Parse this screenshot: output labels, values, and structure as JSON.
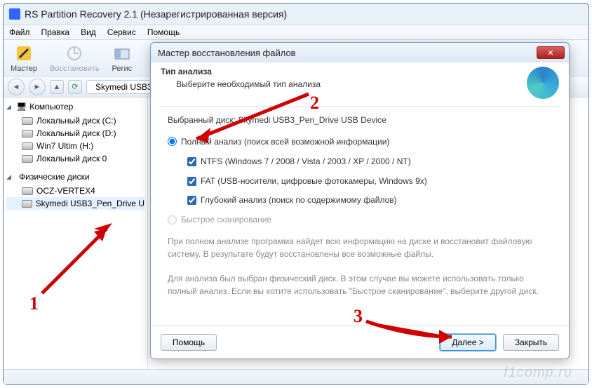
{
  "window": {
    "title": "RS Partition Recovery 2.1 (Незарегистрированная версия)"
  },
  "menu": {
    "file": "Файл",
    "edit": "Правка",
    "view": "Вид",
    "service": "Сервис",
    "help": "Помощь"
  },
  "toolbar": {
    "wizard": "Мастер",
    "recover": "Восстановить",
    "regions": "Регис"
  },
  "breadcrumb": {
    "drive": "Skymedi USB3"
  },
  "tree": {
    "computer": "Компьютер",
    "localC": "Локальный диск (C:)",
    "localD": "Локальный диск (D:)",
    "win7": "Win7 Ultim (H:)",
    "local0": "Локальный диск 0",
    "physical": "Физические диски",
    "ocz": "OCZ-VERTEX4",
    "skymedi": "Skymedi USB3_Pen_Drive U"
  },
  "wizard": {
    "title": "Мастер восстановления файлов",
    "heading": "Тип анализа",
    "subheading": "Выберите необходимый тип анализа",
    "picked_prefix": "Выбранный диск: ",
    "picked_disk": "Skymedi USB3_Pen_Drive USB Device",
    "full_scan": "Полный анализ (поиск всей возможной информации)",
    "ntfs": "NTFS (Windows 7 / 2008 / Vista / 2003 / XP / 2000 / NT)",
    "fat": "FAT (USB-носители, цифровые фотокамеры, Windows 9x)",
    "deep": "Глубокий анализ (поиск по содержимому файлов)",
    "fast_scan": "Быстрое сканирование",
    "info1": "При полном анализе программа найдет всю информацию на диске и восстановит файловую систему. В результате будут восстановлены все возможные файлы.",
    "info2": "Для анализа был выбран физический диск. В этом случае вы можете использовать только полный анализ. Если вы хотите использовать \"Быстрое сканирование\", выберите другой диск.",
    "help": "Помощь",
    "next": "Далее >",
    "close": "Закрыть"
  },
  "annotations": {
    "n1": "1",
    "n2": "2",
    "n3": "3"
  },
  "watermark": "f1comp.ru"
}
